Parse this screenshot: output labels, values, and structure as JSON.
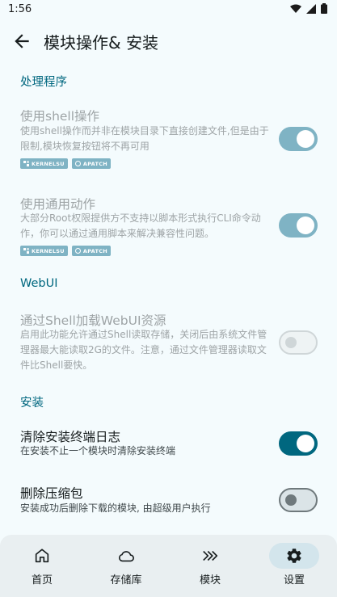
{
  "status": {
    "time": "1:56"
  },
  "header": {
    "title": "模块操作& 安装"
  },
  "sections": {
    "handler": {
      "title": "处理程序"
    },
    "webui": {
      "title": "WebUI"
    },
    "install": {
      "title": "安装"
    }
  },
  "items": {
    "shell": {
      "title": "使用shell操作",
      "desc": "使用shell操作而并非在模块目录下直接创建文件,但是由于限制,模块恢复按钮将不再可用",
      "enabled": true
    },
    "general": {
      "title": "使用通用动作",
      "desc": "大部分Root权限提供方不支持以脚本形式执行CLI命令动作，你可以通过通用脚本来解决兼容性问题。",
      "enabled": true
    },
    "webui_shell": {
      "title": "通过Shell加载WebUI资源",
      "desc": "启用此功能允许通过Shell读取存储，关闭后由系统文件管理器最大能读取2G的文件。注意，通过文件管理器读取文件比Shell要快。",
      "enabled": false
    },
    "clear_log": {
      "title": "清除安装终端日志",
      "desc": "在安装不止一个模块时清除安装终端",
      "enabled": true
    },
    "delete_zip": {
      "title": "删除压缩包",
      "desc": "安装成功后删除下载的模块, 由超级用户执行",
      "enabled": false
    }
  },
  "badges": {
    "kernelsu": "KERNELSU",
    "apatch": "APATCH"
  },
  "nav": [
    {
      "label": "首页",
      "icon": "home-icon",
      "active": false
    },
    {
      "label": "存储库",
      "icon": "cloud-icon",
      "active": false
    },
    {
      "label": "模块",
      "icon": "modules-icon",
      "active": false
    },
    {
      "label": "设置",
      "icon": "settings-gear-icon",
      "active": true
    }
  ],
  "colors": {
    "accent": "#00677f",
    "accent_dim": "#7fb3c4",
    "background": "#f4fbfd",
    "nav_bg": "#e9eff1"
  }
}
